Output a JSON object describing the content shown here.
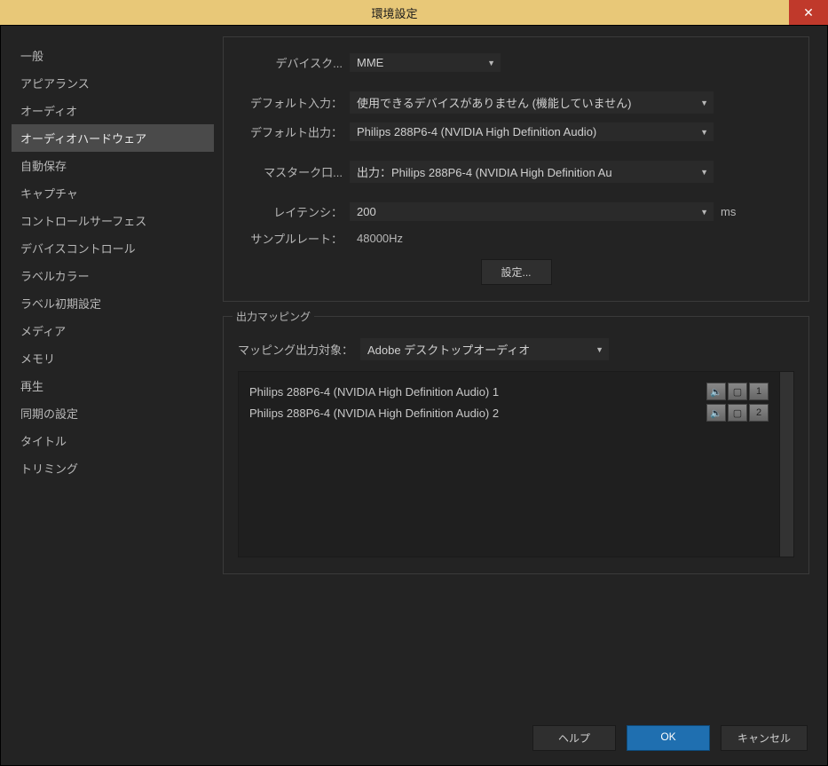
{
  "window": {
    "title": "環境設定"
  },
  "sidebar": {
    "items": [
      {
        "label": "一般"
      },
      {
        "label": "アピアランス"
      },
      {
        "label": "オーディオ"
      },
      {
        "label": "オーディオハードウェア",
        "selected": true
      },
      {
        "label": "自動保存"
      },
      {
        "label": "キャプチャ"
      },
      {
        "label": "コントロールサーフェス"
      },
      {
        "label": "デバイスコントロール"
      },
      {
        "label": "ラベルカラー"
      },
      {
        "label": "ラベル初期設定"
      },
      {
        "label": "メディア"
      },
      {
        "label": "メモリ"
      },
      {
        "label": "再生"
      },
      {
        "label": "同期の設定"
      },
      {
        "label": "タイトル"
      },
      {
        "label": "トリミング"
      }
    ]
  },
  "form": {
    "device_class": {
      "label": "デバイスク...",
      "value": "MME"
    },
    "default_input": {
      "label": "デフォルト入力：",
      "value": "使用できるデバイスがありません (機能していません)"
    },
    "default_output": {
      "label": "デフォルト出力：",
      "value": "Philips 288P6-4 (NVIDIA High Definition Audio)"
    },
    "master_clock": {
      "label": "マスターク口...",
      "value": "出力：Philips 288P6-4 (NVIDIA High Definition Au"
    },
    "latency": {
      "label": "レイテンシ：",
      "value": "200",
      "unit": "ms"
    },
    "sample_rate": {
      "label": "サンプルレート：",
      "value": "48000Hz"
    },
    "settings_button": "設定..."
  },
  "mapping": {
    "group_title": "出力マッピング",
    "target_label": "マッピング出力対象：",
    "target_value": "Adobe デスクトップオーディオ",
    "rows": [
      {
        "label": "Philips 288P6-4 (NVIDIA High Definition Audio) 1",
        "num": "1"
      },
      {
        "label": "Philips 288P6-4 (NVIDIA High Definition Audio) 2",
        "num": "2"
      }
    ]
  },
  "footer": {
    "help": "ヘルプ",
    "ok": "OK",
    "cancel": "キャンセル"
  }
}
